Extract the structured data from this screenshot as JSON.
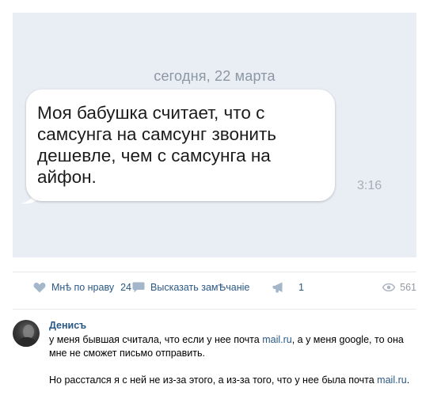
{
  "message_screenshot": {
    "date_label": "сегодня, 22 марта",
    "message_text": "Моя бабушка считает, что с самсунга на самсунг звонить дешевле, чем с самсунга на айфон.",
    "time": "3:16",
    "background_color": "#e9eef5"
  },
  "post_actions": {
    "like_label": "Мнѣ по нраву",
    "like_count": "24",
    "comment_label": "Высказать замѢчаніе",
    "share_count": "1",
    "views_count": "561",
    "link_color": "#2a5885"
  },
  "comment": {
    "author": "Денисъ",
    "paragraph1": {
      "part1": "у меня бывшая считала, что если у нее почта ",
      "link": "mail.ru",
      "part2": ", а у меня google, то она мне не сможет письмо отправить."
    },
    "paragraph2": {
      "part1": "Но расстался я с ней не из-за этого, а из-за того, что у нее была почта ",
      "link": "mail.ru",
      "part2": "."
    }
  }
}
